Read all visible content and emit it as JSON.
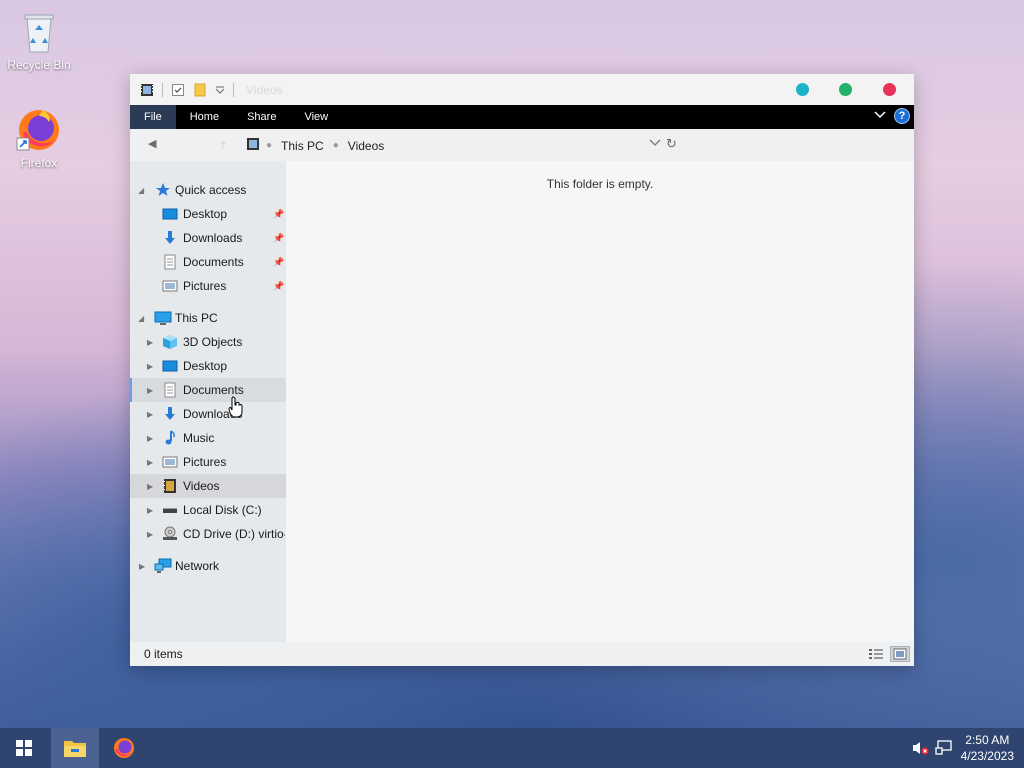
{
  "desktop": {
    "icons": [
      {
        "label": "Recycle Bin",
        "icon": "recycle-bin-icon"
      },
      {
        "label": "Firefox",
        "icon": "firefox-icon"
      }
    ]
  },
  "window": {
    "title": "Videos",
    "ribbon": {
      "tabs": [
        "File",
        "Home",
        "Share",
        "View"
      ],
      "help_label": "?"
    },
    "address": {
      "crumbs": [
        "This PC",
        "Videos"
      ]
    },
    "nav": {
      "quick_access": {
        "label": "Quick access",
        "items": [
          "Desktop",
          "Downloads",
          "Documents",
          "Pictures"
        ]
      },
      "this_pc": {
        "label": "This PC",
        "items": [
          "3D Objects",
          "Desktop",
          "Documents",
          "Downloads",
          "Music",
          "Pictures",
          "Videos",
          "Local Disk (C:)",
          "CD Drive (D:) virtio-"
        ]
      },
      "network": {
        "label": "Network"
      }
    },
    "content": {
      "empty_message": "This folder is empty."
    },
    "status": {
      "item_count": "0 items"
    }
  },
  "taskbar": {
    "time": "2:50 AM",
    "date": "4/23/2023"
  },
  "colors": {
    "accent": "#1e6fd9",
    "window_min": "#1ab3c8",
    "window_max": "#21b36a",
    "window_close": "#e8325a",
    "taskbar": "#2f4570"
  }
}
